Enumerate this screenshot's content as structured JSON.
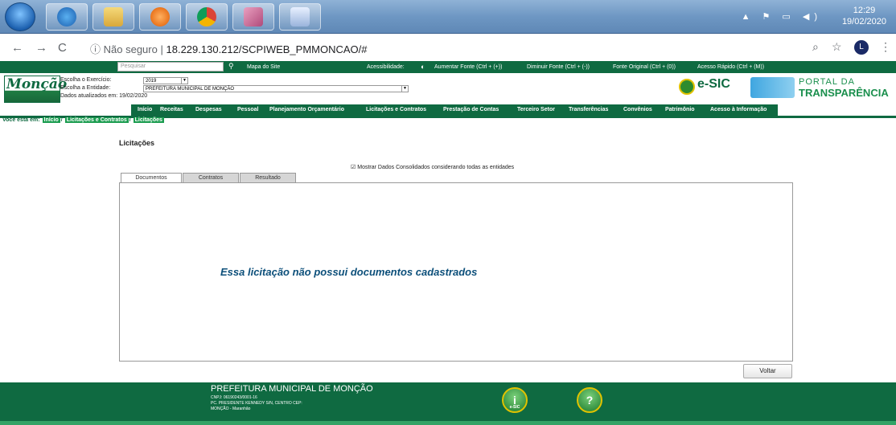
{
  "taskbar": {
    "time": "12:29",
    "date": "19/02/2020"
  },
  "browser": {
    "not_secure": "Não seguro",
    "url": "18.229.130.212/SCPIWEB_PMMONCAO/#",
    "avatar": "L"
  },
  "topbar": {
    "search_placeholder": "Pesquisar",
    "sitemap": "Mapa do Site",
    "accessibility": "Acessibilidade:",
    "increase": "Aumentar Fonte (Ctrl + (+))",
    "decrease": "Diminuir Fonte (Ctrl + (-))",
    "original": "Fonte Original (Ctrl + (0))",
    "quick": "Acesso Rápido (Ctrl + (M))"
  },
  "header": {
    "logo": "Monção",
    "year_label": "Escolha o Exercício:",
    "year_value": "2019",
    "entity_label": "Escolha a Entidade:",
    "entity_value": "PREFEITURA MUNICIPAL DE MONÇÃO",
    "updated": "Dados atualizados em: 19/02/2020",
    "esic": "e-SIC",
    "portal1": "PORTAL DA",
    "portal2": "TRANSPARÊNCIA"
  },
  "menu": [
    "Início",
    "Receitas",
    "Despesas",
    "Pessoal",
    "Planejamento Orçamentário",
    "Licitações e Contratos",
    "Prestação de Contas",
    "Terceiro Setor",
    "Transferências",
    "Convênios",
    "Patrimônio",
    "Acesso à Informação"
  ],
  "breadcrumb": {
    "label": "Você está em:",
    "items": [
      "Início",
      "Licitações e Contratos",
      "Licitações"
    ]
  },
  "page": {
    "title": "Licitações",
    "consolidated": "Mostrar Dados Consolidados considerando todas as entidades",
    "tabs": [
      "Documentos",
      "Contratos",
      "Resultado"
    ],
    "message": "Essa licitação não possui documentos cadastrados",
    "back": "Voltar"
  },
  "footer": {
    "org": "PREFEITURA MUNICIPAL DE MONÇÃO",
    "cnpj": "CNPJ: 06190243/0001-16",
    "address": "PC. PRESIDENTE KENNEDY S/N, CENTRO CEP:",
    "city": "MONÇÃO - Maranhão",
    "esic_label": "e-SIC"
  }
}
